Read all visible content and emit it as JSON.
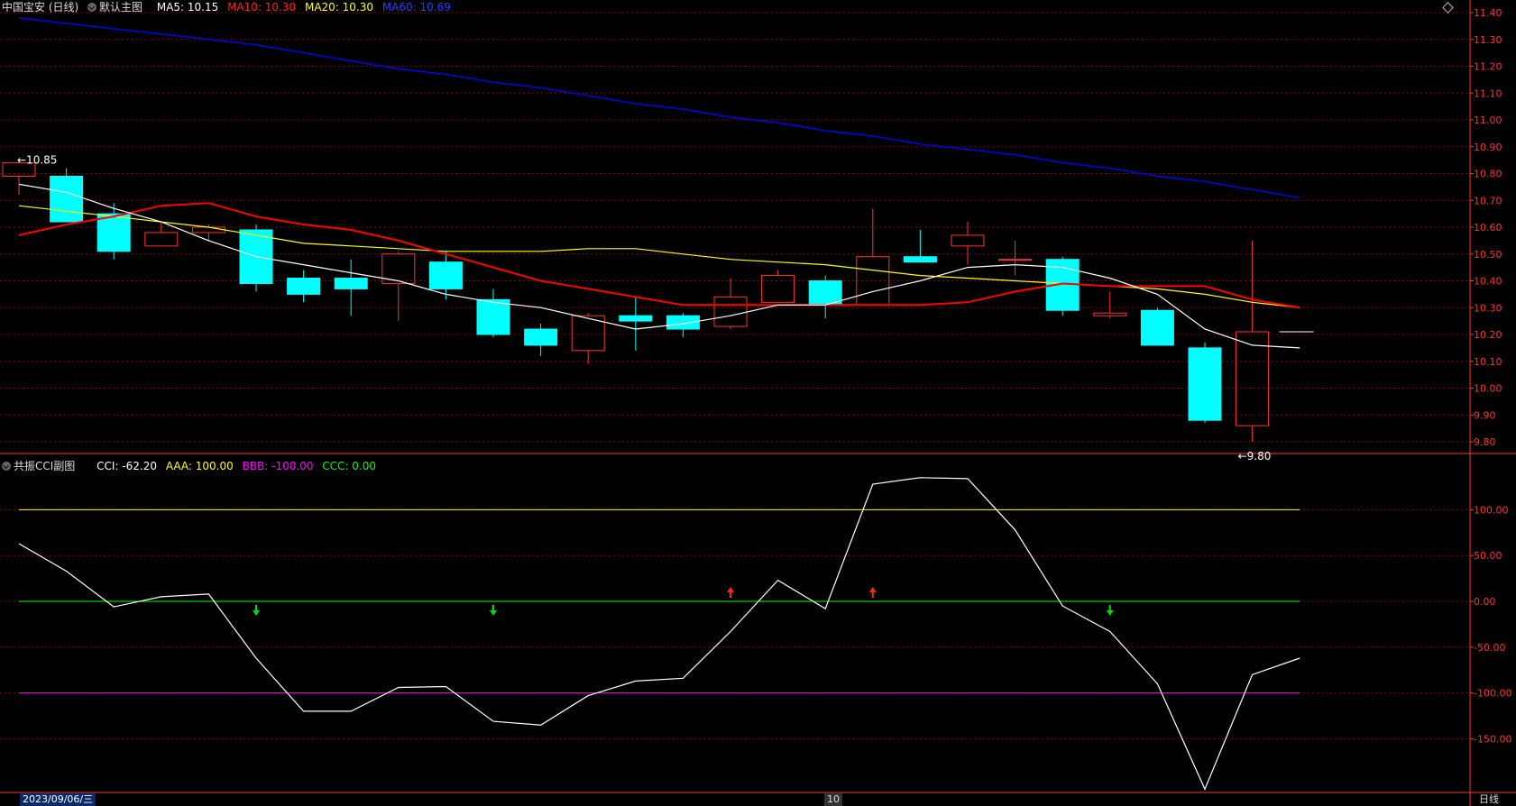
{
  "main_header": {
    "stock_name": "中国宝安 (日线)",
    "chart_name": "默认主图",
    "ma5": "MA5: 10.15",
    "ma10": "MA10: 10.30",
    "ma20": "MA20: 10.30",
    "ma60": "MA60: 10.69"
  },
  "sub_header": {
    "indicator_name": "共振CCI副图",
    "cci": "CCI: -62.20",
    "aaa": "AAA: 100.00",
    "bbb": "BBB: -100.00",
    "ccc": "CCC: 0.00"
  },
  "colors": {
    "up": "#ff3232",
    "down": "#00ffff",
    "ma5": "#ffffff",
    "ma10": "#ff0000",
    "ma20": "#ffff00",
    "ma60": "#0000ff",
    "cci": "#ffffff",
    "aaa": "#ffff00",
    "bbb": "#ff00ff",
    "ccc": "#00ff00",
    "grid": "#8b0000",
    "axis_text": "#ff3232"
  },
  "annotations": {
    "high_label": "10.85",
    "low_label": "9.80"
  },
  "bottom_bar": {
    "date": "2023/09/06/三",
    "month_marker": "10",
    "period": "日线"
  },
  "chart_data": [
    {
      "type": "candlestick",
      "title": "中国宝安 (日线)",
      "ylim": [
        9.8,
        11.4
      ],
      "y_ticks": [
        "11.40",
        "11.30",
        "11.20",
        "11.10",
        "11.00",
        "10.90",
        "10.80",
        "10.70",
        "10.60",
        "10.50",
        "10.40",
        "10.30",
        "10.20",
        "10.10",
        "10.00",
        "9.90",
        "9.80"
      ],
      "candles": [
        {
          "o": 10.79,
          "h": 10.85,
          "l": 10.72,
          "c": 10.84
        },
        {
          "o": 10.79,
          "h": 10.82,
          "l": 10.62,
          "c": 10.62
        },
        {
          "o": 10.65,
          "h": 10.69,
          "l": 10.48,
          "c": 10.51
        },
        {
          "o": 10.53,
          "h": 10.62,
          "l": 10.53,
          "c": 10.58
        },
        {
          "o": 10.58,
          "h": 10.61,
          "l": 10.55,
          "c": 10.6
        },
        {
          "o": 10.59,
          "h": 10.61,
          "l": 10.36,
          "c": 10.39
        },
        {
          "o": 10.41,
          "h": 10.44,
          "l": 10.32,
          "c": 10.35
        },
        {
          "o": 10.41,
          "h": 10.48,
          "l": 10.27,
          "c": 10.37
        },
        {
          "o": 10.39,
          "h": 10.51,
          "l": 10.25,
          "c": 10.5
        },
        {
          "o": 10.47,
          "h": 10.51,
          "l": 10.33,
          "c": 10.37
        },
        {
          "o": 10.33,
          "h": 10.37,
          "l": 10.19,
          "c": 10.2
        },
        {
          "o": 10.22,
          "h": 10.24,
          "l": 10.12,
          "c": 10.16
        },
        {
          "o": 10.14,
          "h": 10.28,
          "l": 10.09,
          "c": 10.27
        },
        {
          "o": 10.27,
          "h": 10.34,
          "l": 10.14,
          "c": 10.25
        },
        {
          "o": 10.27,
          "h": 10.28,
          "l": 10.19,
          "c": 10.22
        },
        {
          "o": 10.23,
          "h": 10.41,
          "l": 10.22,
          "c": 10.34
        },
        {
          "o": 10.32,
          "h": 10.44,
          "l": 10.32,
          "c": 10.42
        },
        {
          "o": 10.4,
          "h": 10.42,
          "l": 10.26,
          "c": 10.31
        },
        {
          "o": 10.31,
          "h": 10.67,
          "l": 10.31,
          "c": 10.49
        },
        {
          "o": 10.49,
          "h": 10.59,
          "l": 10.47,
          "c": 10.47
        },
        {
          "o": 10.53,
          "h": 10.62,
          "l": 10.46,
          "c": 10.57
        },
        {
          "o": 10.48,
          "h": 10.55,
          "l": 10.42,
          "c": 10.48
        },
        {
          "o": 10.48,
          "h": 10.49,
          "l": 10.27,
          "c": 10.29
        },
        {
          "o": 10.27,
          "h": 10.36,
          "l": 10.26,
          "c": 10.28
        },
        {
          "o": 10.29,
          "h": 10.3,
          "l": 10.16,
          "c": 10.16
        },
        {
          "o": 10.15,
          "h": 10.17,
          "l": 9.87,
          "c": 9.88
        },
        {
          "o": 9.86,
          "h": 10.55,
          "l": 9.8,
          "c": 10.21
        }
      ],
      "last_price_line": 10.21,
      "ma5": [
        10.76,
        10.73,
        10.67,
        10.62,
        10.55,
        10.49,
        10.46,
        10.43,
        10.4,
        10.35,
        10.32,
        10.3,
        10.26,
        10.22,
        10.24,
        10.27,
        10.31,
        10.31,
        10.36,
        10.4,
        10.45,
        10.46,
        10.45,
        10.41,
        10.35,
        10.22,
        10.16,
        10.15
      ],
      "ma10": [
        10.57,
        10.61,
        10.64,
        10.68,
        10.69,
        10.64,
        10.61,
        10.59,
        10.55,
        10.5,
        10.45,
        10.4,
        10.37,
        10.34,
        10.31,
        10.31,
        10.31,
        10.31,
        10.31,
        10.31,
        10.32,
        10.36,
        10.39,
        10.38,
        10.38,
        10.38,
        10.33,
        10.3
      ],
      "ma20": [
        10.68,
        10.66,
        10.64,
        10.62,
        10.6,
        10.57,
        10.54,
        10.53,
        10.52,
        10.51,
        10.51,
        10.51,
        10.52,
        10.52,
        10.5,
        10.48,
        10.47,
        10.46,
        10.44,
        10.42,
        10.41,
        10.4,
        10.39,
        10.38,
        10.37,
        10.35,
        10.32,
        10.3
      ],
      "ma60": [
        11.38,
        11.36,
        11.34,
        11.32,
        11.3,
        11.28,
        11.25,
        11.22,
        11.19,
        11.17,
        11.14,
        11.12,
        11.09,
        11.06,
        11.04,
        11.01,
        10.99,
        10.96,
        10.94,
        10.91,
        10.89,
        10.87,
        10.84,
        10.82,
        10.79,
        10.77,
        10.74,
        10.71
      ]
    },
    {
      "type": "line",
      "title": "共振CCI副图",
      "ylim": [
        -210,
        150
      ],
      "y_ticks": [
        "100.00",
        "50.00",
        "0.00",
        "-50.00",
        "-100.00",
        "-150.00"
      ],
      "series": [
        {
          "name": "CCI",
          "values": [
            63,
            33,
            -6,
            5,
            8,
            -62,
            -120,
            -120,
            -94,
            -93,
            -131,
            -135,
            -103,
            -87,
            -84,
            -33,
            23,
            -8,
            128,
            135,
            134,
            78,
            -5,
            -33,
            -90,
            -205,
            -80,
            -62
          ]
        },
        {
          "name": "AAA",
          "values": [
            100
          ]
        },
        {
          "name": "BBB",
          "values": [
            -100
          ]
        },
        {
          "name": "CCC",
          "values": [
            0
          ]
        }
      ],
      "signals": [
        {
          "index": 5,
          "direction": "down"
        },
        {
          "index": 10,
          "direction": "down"
        },
        {
          "index": 15,
          "direction": "up"
        },
        {
          "index": 18,
          "direction": "up"
        },
        {
          "index": 23,
          "direction": "down"
        }
      ]
    }
  ]
}
